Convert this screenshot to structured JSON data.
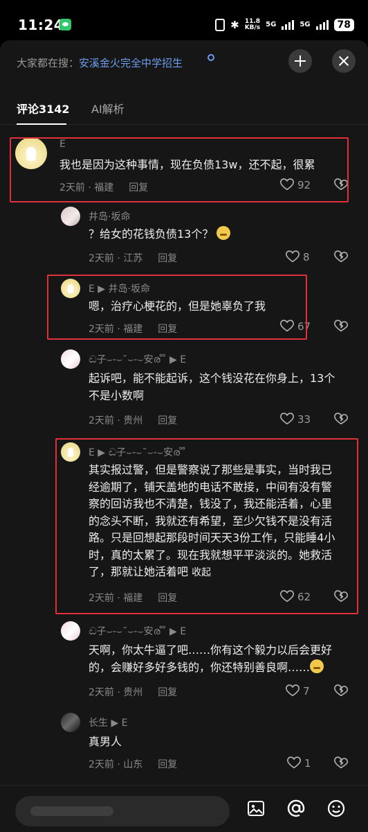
{
  "status_bar": {
    "time": "11:24",
    "net_speed_value": "11.8",
    "net_speed_unit": "KB/s",
    "signal1": "5G",
    "signal2": "5G",
    "battery": "78"
  },
  "header": {
    "search_prefix": "大家都在搜：",
    "search_keyword": "安溪金火完全中学招生"
  },
  "tabs": [
    {
      "label": "评论3142",
      "active": true
    },
    {
      "label": "AI解析",
      "active": false
    }
  ],
  "comments": [
    {
      "user": "E",
      "text": "我也是因为这种事情，现在负债13w，还不起，很累",
      "time": "2天前",
      "location": "福建",
      "reply_label": "回复",
      "likes": "92"
    },
    {
      "user": "井岛·坂命",
      "text": "？给女的花钱负债13个？",
      "time": "2天前",
      "location": "江苏",
      "reply_label": "回复",
      "likes": "8"
    },
    {
      "user": "E",
      "reply_to": "井岛·坂命",
      "text": "嗯，治疗心梗花的，但是她辜负了我",
      "time": "2天前",
      "location": "福建",
      "reply_label": "回复",
      "likes": "67"
    },
    {
      "user": "ඬ子⌣-⌣˘⌣-⌣安ര ̊ ̊",
      "reply_to": "E",
      "text_lines": [
        "起诉吧，能不能起诉，这个钱没花在你身上，13个",
        "不是小数啊"
      ],
      "time": "2天前",
      "location": "贵州",
      "reply_label": "回复",
      "likes": "33"
    },
    {
      "user": "E",
      "reply_to": "ඬ子⌣-⌣˘⌣-⌣安ര ̊ ̊",
      "text_lines": [
        "其实报过警，但是警察说了那些是事实，当时我已",
        "经逾期了，铺天盖地的电话不敢接，中间有没有警",
        "察的回访我也不清楚，钱没了，我还能活着，心里",
        "的念头不断，我就还有希望，至少欠钱不是没有活",
        "路。只是回想起那段时间天天3份工作，只能睡4小",
        "时，真的太累了。现在我就想平平淡淡的。她救活",
        "了，那就让她活着吧"
      ],
      "collapse_label": "收起",
      "time": "2天前",
      "location": "福建",
      "reply_label": "回复",
      "likes": "62"
    },
    {
      "user": "ඬ子⌣-⌣˘⌣-⌣安ര ̊ ̊",
      "reply_to": "E",
      "text_lines": [
        "天啊，你太牛逼了吧……你有这个毅力以后会更好",
        "的，会赚好多好多钱的，你还特别善良啊……"
      ],
      "time": "2天前",
      "location": "贵州",
      "reply_label": "回复",
      "likes": "7"
    },
    {
      "user": "长生",
      "reply_to": "E",
      "text": "真男人",
      "time": "2天前",
      "location": "山东",
      "reply_label": "回复",
      "likes": "1"
    }
  ],
  "colors": {
    "background": "#161616",
    "highlight_box": "#e0313a",
    "search_keyword": "#6c9cec"
  },
  "icons": [
    "wechat-icon",
    "search-icon",
    "collapse-icon",
    "close-icon",
    "heart-icon",
    "dislike-icon",
    "image-icon",
    "at-icon",
    "emoji-icon"
  ]
}
